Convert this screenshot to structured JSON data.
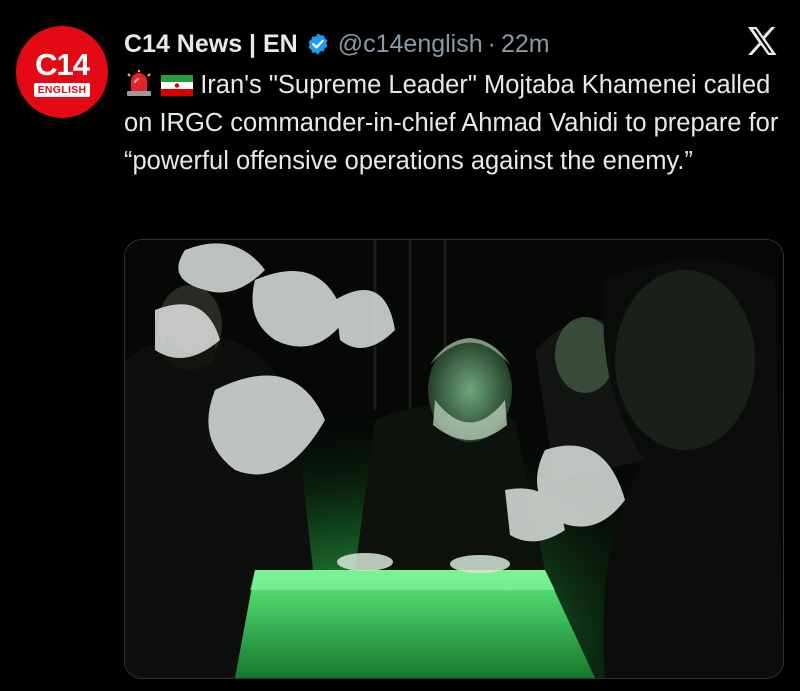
{
  "account": {
    "avatar_logo": "C14",
    "avatar_subtitle": "ENGLISH",
    "display_name": "C14 News | EN",
    "handle": "@c14english",
    "separator": "·",
    "timestamp": "22m",
    "verified_color": "#1d9bf0"
  },
  "tweet": {
    "emoji_1": "siren-emoji",
    "emoji_2": "iran-flag-emoji",
    "text": "Iran's \"Supreme Leader\" Mojtaba Khamenei called on IRGC commander-in-chief Ahmad Vahidi to prepare for “powerful offensive operations against the enemy.”"
  },
  "media": {
    "description_icon": "photo-image"
  },
  "colors": {
    "background": "#000000",
    "text_primary": "#e7e9ea",
    "text_secondary": "#8b98a5",
    "brand_red": "#e30a16",
    "green_light": "#2fd35a"
  }
}
